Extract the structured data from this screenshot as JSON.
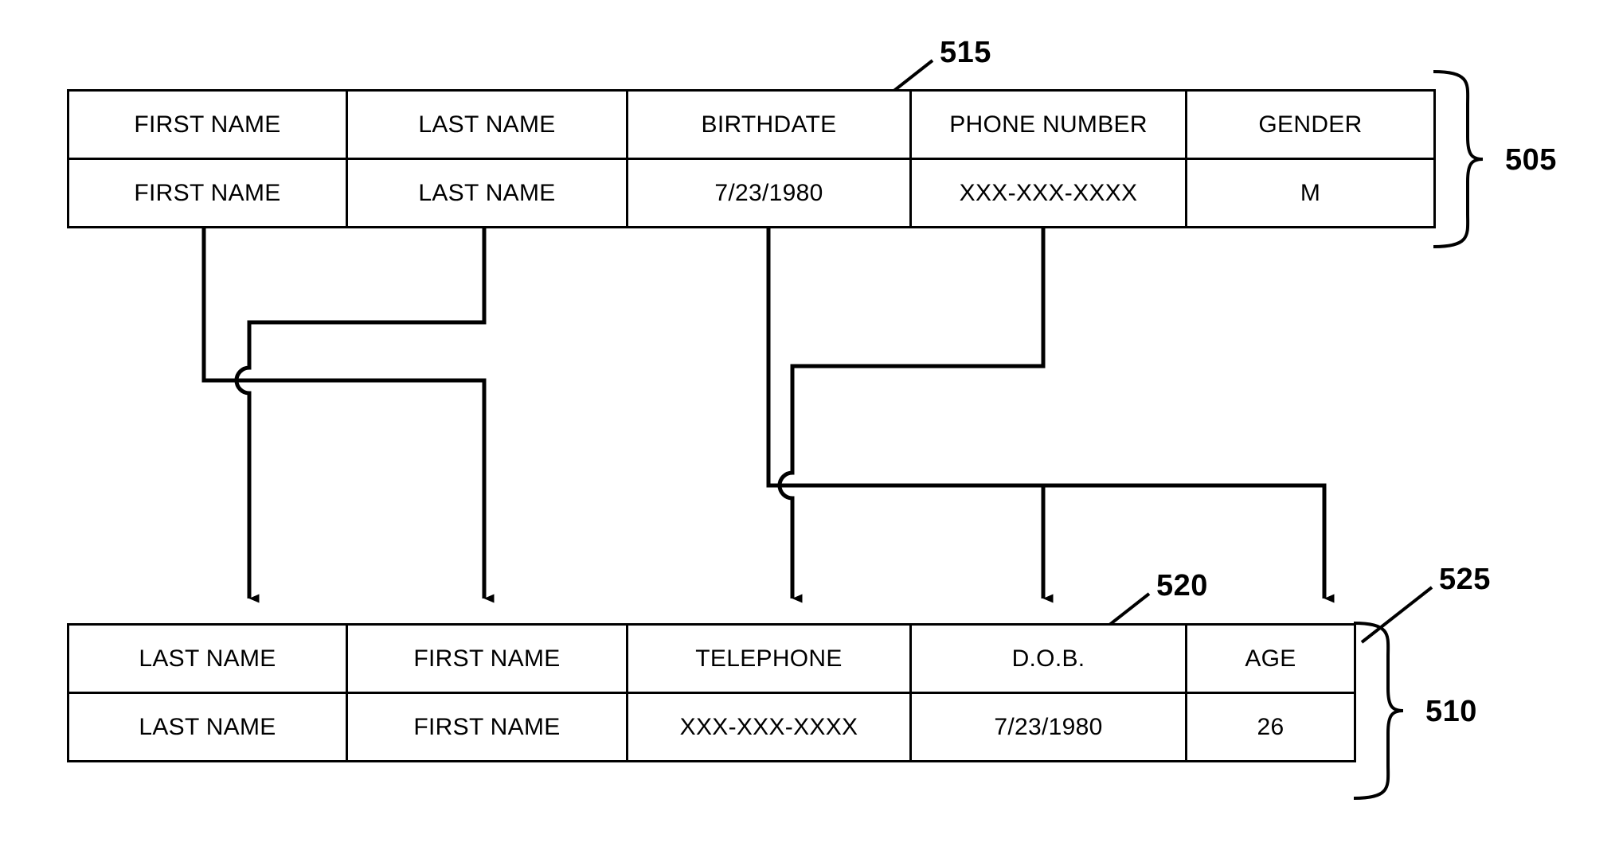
{
  "figure": {
    "title": "Data field mapping between source and destination record tables",
    "background_color": "#ffffff",
    "line_color": "#000000"
  },
  "source_table": {
    "ref": "505",
    "columns": [
      "FIRST NAME",
      "LAST NAME",
      "BIRTHDATE",
      "PHONE NUMBER",
      "GENDER"
    ],
    "rows": [
      [
        "FIRST NAME",
        "LAST NAME",
        "7/23/1980",
        "XXX-XXX-XXXX",
        "M"
      ]
    ]
  },
  "destination_table": {
    "ref": "510",
    "columns": [
      "LAST NAME",
      "FIRST NAME",
      "TELEPHONE",
      "D.O.B.",
      "AGE"
    ],
    "rows": [
      [
        "LAST NAME",
        "FIRST NAME",
        "XXX-XXX-XXXX",
        "7/23/1980",
        "26"
      ]
    ]
  },
  "callouts": [
    {
      "ref": "515",
      "target": "source-birthdate-header"
    },
    {
      "ref": "505",
      "target": "source-table-brace"
    },
    {
      "ref": "520",
      "target": "destination-dob-header"
    },
    {
      "ref": "525",
      "target": "destination-age-header"
    },
    {
      "ref": "510",
      "target": "destination-table-brace"
    }
  ],
  "mappings": [
    {
      "from": "FIRST NAME",
      "to": "FIRST NAME",
      "crosses": true
    },
    {
      "from": "LAST NAME",
      "to": "LAST NAME",
      "crosses": true
    },
    {
      "from": "BIRTHDATE",
      "to": "D.O.B.",
      "crosses": true
    },
    {
      "from": "PHONE NUMBER",
      "to": "TELEPHONE",
      "crosses": true
    },
    {
      "from": "BIRTHDATE",
      "to": "AGE",
      "crosses": false
    }
  ]
}
